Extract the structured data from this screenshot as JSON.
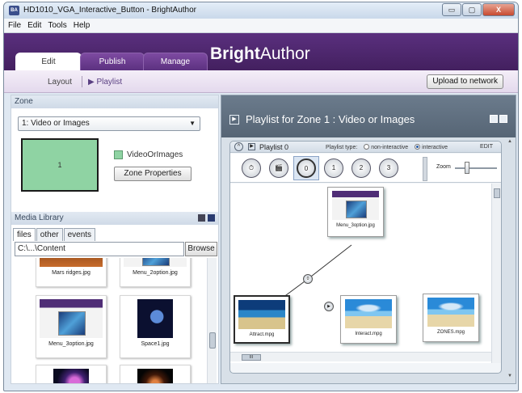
{
  "window": {
    "title": "HD1010_VGA_Interactive_Button - BrightAuthor",
    "app_icon": "BA",
    "controls": {
      "minimize": "▭",
      "maximize": "▢",
      "close": "X"
    }
  },
  "menu": [
    "File",
    "Edit",
    "Tools",
    "Help"
  ],
  "header": {
    "brand_bold": "Bright",
    "brand_rest": "Author",
    "tabs": [
      "Edit",
      "Publish",
      "Manage"
    ],
    "active_tab": "Edit",
    "colors": {
      "band": "#4f2870",
      "active_tab": "#ffffff"
    }
  },
  "subbar": {
    "layout_link": "Layout",
    "playlist_link": "▶ Playlist",
    "upload_button": "Upload to network"
  },
  "zone": {
    "section_title": "Zone",
    "selected": "1: Video or Images",
    "preview_label": "1",
    "legend_label": "VideoOrImages",
    "props_button": "Zone Properties",
    "color": "#8fd3a3"
  },
  "media_library": {
    "section_title": "Media Library",
    "tabs": [
      "files",
      "other",
      "events"
    ],
    "active_tab": "files",
    "path": "C:\\...\\Content",
    "browse_button": "Browse",
    "items": [
      {
        "caption": "Mars ridges.jpg",
        "thumb": "mars"
      },
      {
        "caption": "Menu_2option.jpg",
        "thumb": "menu"
      },
      {
        "caption": "Menu_3option.jpg",
        "thumb": "menu"
      },
      {
        "caption": "Space1.jpg",
        "thumb": "space"
      },
      {
        "caption": "",
        "thumb": "nebula"
      },
      {
        "caption": "",
        "thumb": "galaxy"
      }
    ]
  },
  "playlist_panel": {
    "title": "Playlist for Zone 1 : Video or Images",
    "playlist_name": "Playlist 0",
    "playlist_type_label": "Playlist type:",
    "type_options": [
      "non-interactive",
      "interactive"
    ],
    "selected_type": "interactive",
    "edit_label": "EDIT",
    "zoom_label": "Zoom",
    "tool_icons": [
      "timer-icon",
      "video-clapper-icon",
      "button-0-icon",
      "button-1-icon",
      "button-2-icon",
      "button-3-icon"
    ],
    "tool_labels": [
      "⏱",
      "🎬",
      "0",
      "1",
      "2",
      "3"
    ],
    "scroll_label": "III",
    "nodes": [
      {
        "caption": "Menu_3option.jpg",
        "thumb": "menu"
      },
      {
        "caption": "Attract.mpg",
        "thumb": "attract"
      },
      {
        "caption": "Interact.mpg",
        "thumb": "beach"
      },
      {
        "caption": "ZONES.mpg",
        "thumb": "beach"
      }
    ],
    "event_labels": [
      "0",
      "▶"
    ]
  }
}
